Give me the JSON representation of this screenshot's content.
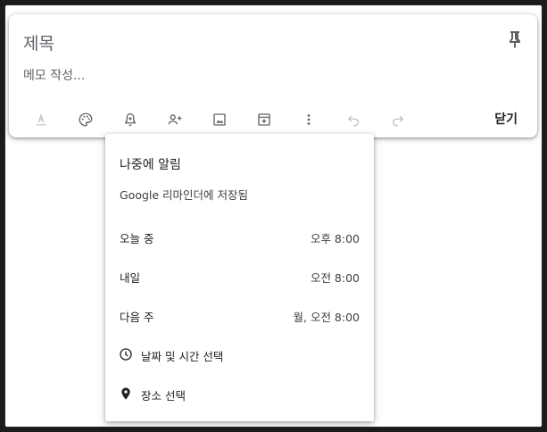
{
  "note": {
    "title_placeholder": "제목",
    "body_placeholder": "메모 작성...",
    "close_label": "닫기"
  },
  "toolbar_icons": [
    "text-format-icon",
    "palette-icon",
    "reminder-bell-icon",
    "add-collaborator-icon",
    "image-icon",
    "archive-icon",
    "more-vert-icon",
    "undo-icon",
    "redo-icon"
  ],
  "reminder_menu": {
    "title": "나중에 알림",
    "subtitle": "Google 리마인더에 저장됨",
    "options": [
      {
        "label": "오늘 중",
        "time": "오후 8:00"
      },
      {
        "label": "내일",
        "time": "오전 8:00"
      },
      {
        "label": "다음 주",
        "time": "월, 오전 8:00"
      }
    ],
    "pick_datetime": "날짜 및 시간 선택",
    "pick_place": "장소 선택"
  }
}
